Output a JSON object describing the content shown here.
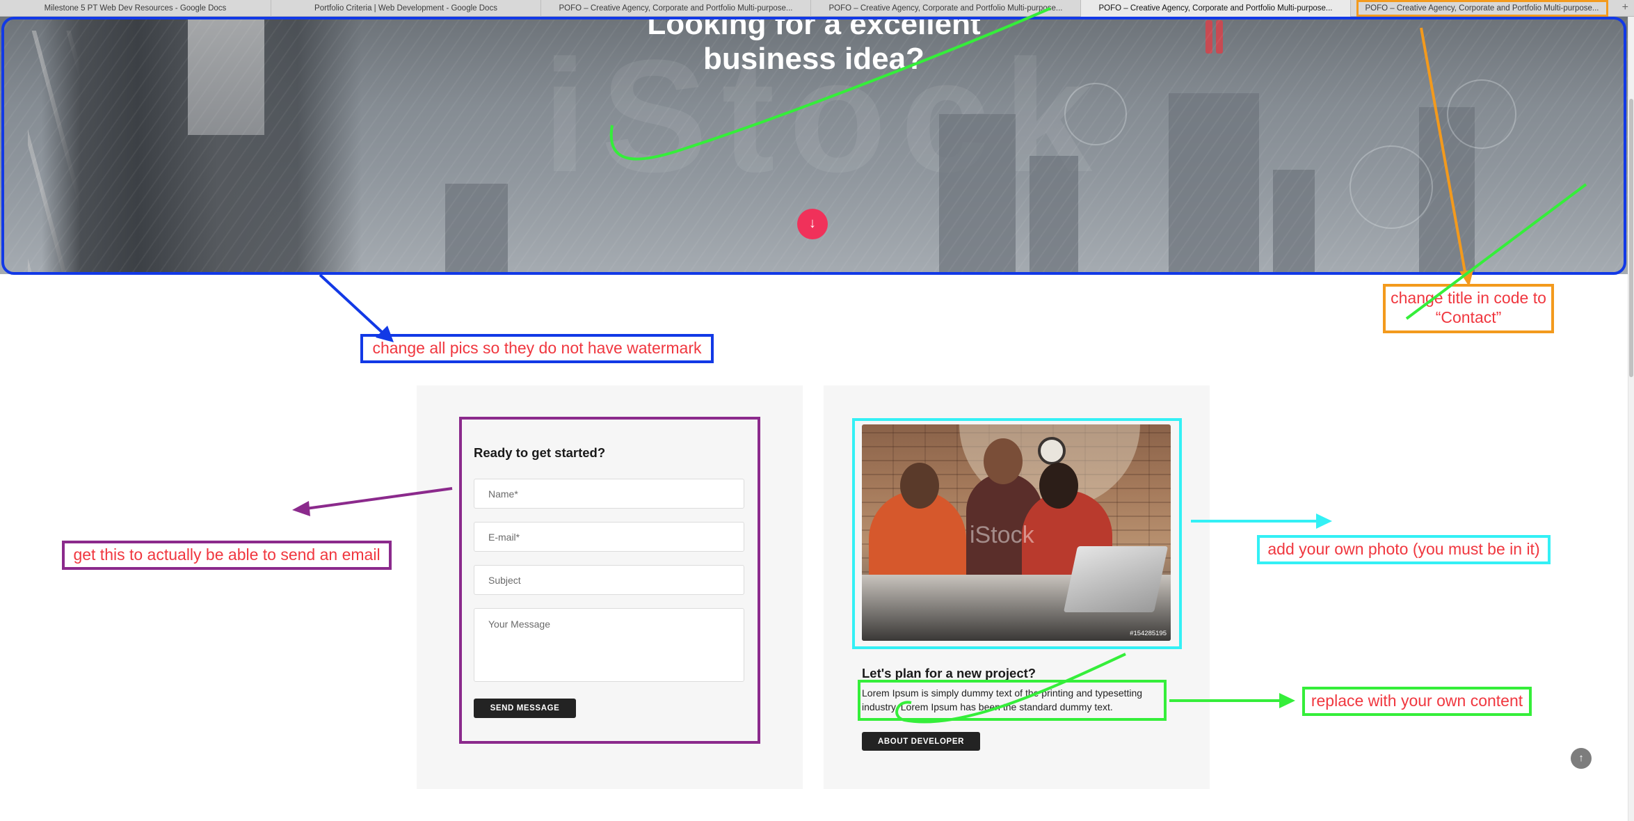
{
  "browser": {
    "tabs": [
      "Milestone 5 PT Web Dev Resources - Google Docs",
      "Portfolio Criteria | Web Development - Google Docs",
      "POFO – Creative Agency, Corporate and Portfolio Multi-purpose...",
      "POFO – Creative Agency, Corporate and Portfolio Multi-purpose...",
      "POFO – Creative Agency, Corporate and Portfolio Multi-purpose...",
      "POFO – Creative Agency, Corporate and Portfolio Multi-purpose..."
    ],
    "new_tab_symbol": "+"
  },
  "hero": {
    "headline_line1": "Looking for a excellent",
    "headline_line2": "business idea?",
    "down_icon": "↓"
  },
  "contact_form": {
    "title": "Ready to get started?",
    "name_placeholder": "Name*",
    "email_placeholder": "E-mail*",
    "subject_placeholder": "Subject",
    "message_placeholder": "Your Message",
    "submit_label": "SEND MESSAGE"
  },
  "about": {
    "image_watermark": "iStock",
    "image_id": "#154285195",
    "title": "Let's plan for a new project?",
    "body": "Lorem Ipsum is simply dummy text of the printing and typesetting industry. Lorem Ipsum has been the standard dummy text.",
    "button_label": "ABOUT DEVELOPER"
  },
  "annotations": {
    "watermark_note": "change all pics so they do not have watermark",
    "title_note_line1": "change title in code to",
    "title_note_line2": "“Contact”",
    "email_note": "get this to actually be able to send an email",
    "photo_note": "add your own photo (you must be in it)",
    "content_note": "replace with your own content"
  },
  "scroll_top_icon": "↑",
  "colors": {
    "annotation_blue": "#1239e6",
    "annotation_orange": "#f39a1d",
    "annotation_purple": "#8b2a8c",
    "annotation_cyan": "#33f0f5",
    "annotation_green": "#35ee3a",
    "annotation_text": "#f0373f",
    "accent_pink": "#f0315a"
  }
}
